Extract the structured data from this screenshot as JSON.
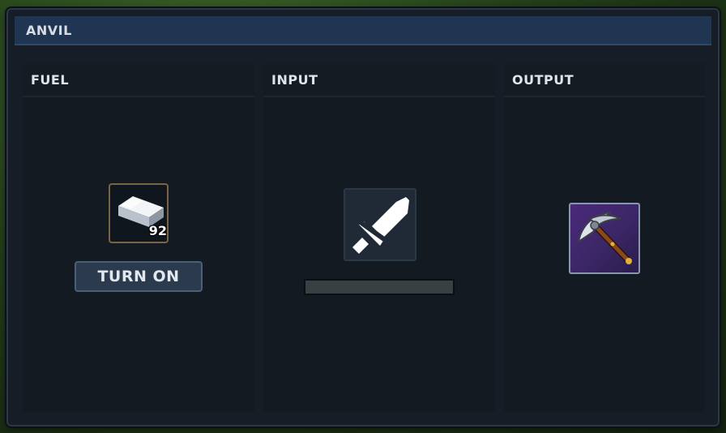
{
  "window": {
    "title": "ANVIL"
  },
  "panels": {
    "fuel": {
      "title": "FUEL",
      "slot": {
        "item_icon": "iron-ingot-icon",
        "count": "92"
      },
      "button_label": "TURN ON"
    },
    "input": {
      "title": "INPUT",
      "slot": {
        "item_icon": "broken-sword-icon"
      },
      "progress": 0
    },
    "output": {
      "title": "OUTPUT",
      "slot": {
        "item_icon": "pickaxe-icon"
      }
    }
  },
  "colors": {
    "window_bg": "#161d26",
    "title_bar": "#1f3552",
    "fuel_slot_border": "#7a6448",
    "output_slot_bg": "#4a2a7a",
    "button_bg": "#2b3a4d"
  }
}
